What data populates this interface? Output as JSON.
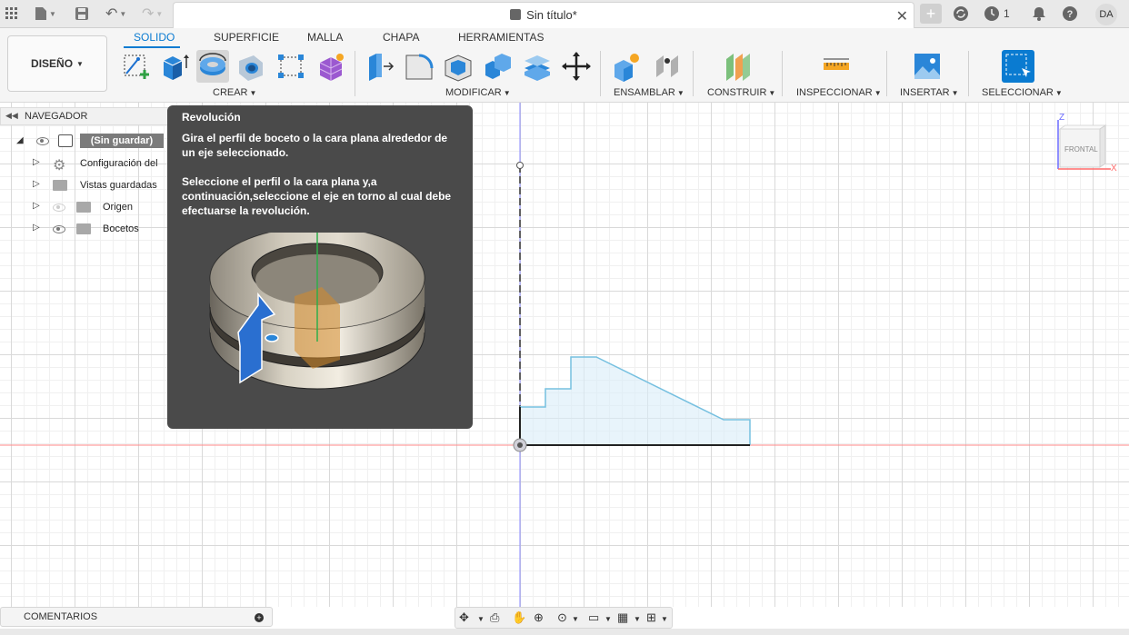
{
  "window": {
    "title": "Sin título*"
  },
  "titlebar": {
    "job_count": "1",
    "user_initials": "DA"
  },
  "ribbon": {
    "workspace_label": "DISEÑO",
    "tabs": [
      {
        "label": "SOLIDO",
        "active": true
      },
      {
        "label": "SUPERFICIE",
        "active": false
      },
      {
        "label": "MALLA",
        "active": false
      },
      {
        "label": "CHAPA",
        "active": false
      },
      {
        "label": "HERRAMIENTAS",
        "active": false
      }
    ],
    "groups": {
      "crear": "CREAR",
      "modificar": "MODIFICAR",
      "ensamblar": "ENSAMBLAR",
      "construir": "CONSTRUIR",
      "inspeccionar": "INSPECCIONAR",
      "insertar": "INSERTAR",
      "seleccionar": "SELECCIONAR"
    }
  },
  "navigator": {
    "title": "NAVEGADOR",
    "root": "(Sin guardar)",
    "items": [
      {
        "label": "Configuración del",
        "visible": null
      },
      {
        "label": "Vistas guardadas",
        "visible": null
      },
      {
        "label": "Origen",
        "visible": false
      },
      {
        "label": "Bocetos",
        "visible": true
      }
    ]
  },
  "tooltip": {
    "title": "Revolución",
    "line1": "Gira el perfil de boceto o la cara plana alrededor de un eje seleccionado.",
    "line2": "Seleccione el perfil o la cara plana y,a continuación,seleccione el eje en torno al cual debe efectuarse la revolución."
  },
  "viewcube": {
    "face_label": "FRONTAL",
    "axis_z": "Z",
    "axis_x": "X"
  },
  "bottom": {
    "comments_label": "COMENTARIOS"
  },
  "colors": {
    "accent": "#0a7bd1",
    "sketch_line": "#76c0e0",
    "x_axis": "#ff8a8a",
    "y_axis": "#8a8aff"
  }
}
